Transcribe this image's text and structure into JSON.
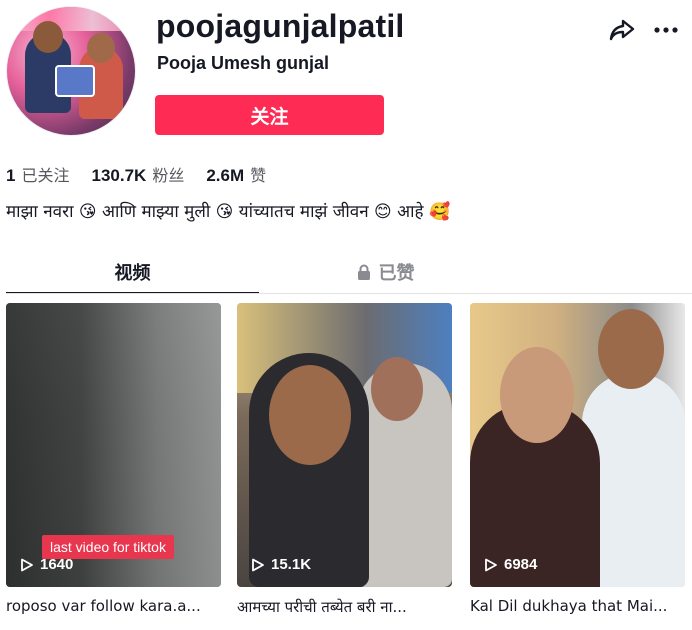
{
  "profile": {
    "username": "poojagunjalpatil",
    "display_name": "Pooja Umesh gunjal",
    "follow_label": "关注",
    "bio": "माझा नवरा 😘 आणि माझ्या मुली 😘 यांच्यातच माझं जीवन 😊 आहे 🥰"
  },
  "stats": {
    "following_count": "1",
    "following_label": "已关注",
    "followers_count": "130.7K",
    "followers_label": "粉丝",
    "likes_count": "2.6M",
    "likes_label": "赞"
  },
  "tabs": {
    "videos": "视频",
    "liked": "已赞"
  },
  "videos": [
    {
      "views": "1640",
      "caption": "roposo var follow kara.a...",
      "overlay_text": "last video for tiktok"
    },
    {
      "views": "15.1K",
      "caption": "आमच्या परीची तब्येत बरी ना..."
    },
    {
      "views": "6984",
      "caption": "Kal Dil dukhaya that Mai..."
    }
  ],
  "colors": {
    "accent": "#fe2c55",
    "text_primary": "#161823",
    "text_secondary": "#57585e"
  }
}
